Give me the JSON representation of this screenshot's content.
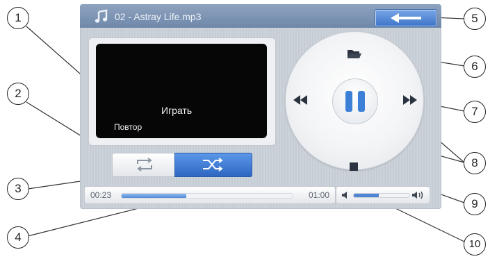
{
  "titlebar": {
    "icon": "music-note-icon",
    "track_name": "02 - Astray Life.mp3",
    "back_icon": "back-arrow-icon"
  },
  "screen": {
    "play_label": "Играть",
    "repeat_label": "Повтор"
  },
  "mode_buttons": {
    "repeat_icon": "repeat-icon",
    "shuffle_icon": "shuffle-icon"
  },
  "seek": {
    "current_time": "00:23",
    "total_time": "01:00",
    "progress": 0.38
  },
  "volume": {
    "level": 0.45,
    "low_icon": "volume-low-icon",
    "high_icon": "volume-high-icon"
  },
  "controls": {
    "folder_icon": "folder-icon",
    "pause_icon": "pause-icon",
    "rewind_icon": "rewind-icon",
    "fast_forward_icon": "fast-forward-icon",
    "stop_icon": "stop-icon"
  },
  "callouts": [
    "1",
    "2",
    "3",
    "4",
    "5",
    "6",
    "7",
    "8",
    "9",
    "10"
  ],
  "colors": {
    "accent": "#3d74c8",
    "titlebar": "#7b91b2",
    "screen": "#060606"
  }
}
